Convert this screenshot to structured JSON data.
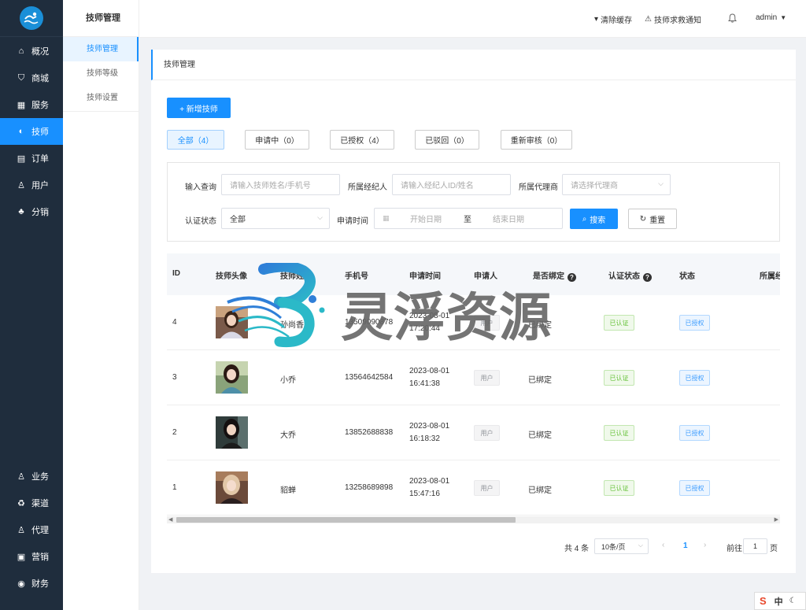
{
  "sidebar": {
    "logo_icon": "swimmer-logo-icon",
    "items": [
      {
        "label": "概况",
        "icon": "home-icon"
      },
      {
        "label": "商城",
        "icon": "bag-icon"
      },
      {
        "label": "服务",
        "icon": "calendar-icon"
      },
      {
        "label": "技师",
        "icon": "technician-icon",
        "active": true
      },
      {
        "label": "订单",
        "icon": "order-icon"
      },
      {
        "label": "用户",
        "icon": "user-icon"
      },
      {
        "label": "分销",
        "icon": "distribution-icon"
      }
    ],
    "bottom_items": [
      {
        "label": "业务",
        "icon": "business-icon"
      },
      {
        "label": "渠道",
        "icon": "channel-icon"
      },
      {
        "label": "代理",
        "icon": "agent-icon"
      },
      {
        "label": "营销",
        "icon": "marketing-icon"
      },
      {
        "label": "财务",
        "icon": "finance-icon"
      }
    ]
  },
  "submenu": {
    "title": "技师管理",
    "items": [
      "技师管理",
      "技师等级",
      "技师设置"
    ]
  },
  "header": {
    "clear_cache": "清除缓存",
    "sos_notice": "技师求救通知",
    "user": "admin"
  },
  "main": {
    "title": "技师管理",
    "add_button": "+ 新增技师",
    "tabs": [
      "全部（4）",
      "申请中（0）",
      "已授权（4）",
      "已驳回（0）",
      "重新审核（0）"
    ],
    "filters": {
      "query_label": "输入查询",
      "query_placeholder": "请输入技师姓名/手机号",
      "broker_label": "所属经纪人",
      "broker_placeholder": "请输入经纪人ID/姓名",
      "agent_label": "所属代理商",
      "agent_placeholder": "请选择代理商",
      "auth_label": "认证状态",
      "auth_value": "全部",
      "time_label": "申请时间",
      "start_placeholder": "开始日期",
      "range_sep": "至",
      "end_placeholder": "结束日期",
      "search_button": "搜索",
      "reset_button": "重置"
    },
    "table": {
      "columns": [
        "ID",
        "技师头像",
        "技师姓名",
        "手机号",
        "申请时间",
        "申请人",
        "是否绑定",
        "认证状态",
        "状态",
        "所属经纪人"
      ],
      "rows": [
        {
          "id": "4",
          "name": "孙尚香",
          "phone": "13509090878",
          "date": "2023-08-01",
          "time": "17:20:44",
          "applicant": "用户",
          "bound": "已绑定",
          "auth": "已认证",
          "status": "已授权"
        },
        {
          "id": "3",
          "name": "小乔",
          "phone": "13564642584",
          "date": "2023-08-01",
          "time": "16:41:38",
          "applicant": "用户",
          "bound": "已绑定",
          "auth": "已认证",
          "status": "已授权"
        },
        {
          "id": "2",
          "name": "大乔",
          "phone": "13852688838",
          "date": "2023-08-01",
          "time": "16:18:32",
          "applicant": "用户",
          "bound": "已绑定",
          "auth": "已认证",
          "status": "已授权"
        },
        {
          "id": "1",
          "name": "貂蝉",
          "phone": "13258689898",
          "date": "2023-08-01",
          "time": "15:47:16",
          "applicant": "用户",
          "bound": "已绑定",
          "auth": "已认证",
          "status": "已授权"
        }
      ]
    },
    "pagination": {
      "total": "共 4 条",
      "page_size": "10条/页",
      "current": "1",
      "goto_label": "前往",
      "goto_value": "1",
      "page_suffix": "页"
    }
  },
  "watermark": {
    "text": "灵浮资源"
  },
  "ime": {
    "mode": "中"
  },
  "colors": {
    "sidebar_bg": "#1f2d3d",
    "primary": "#1890ff",
    "success": "#67c23a"
  }
}
